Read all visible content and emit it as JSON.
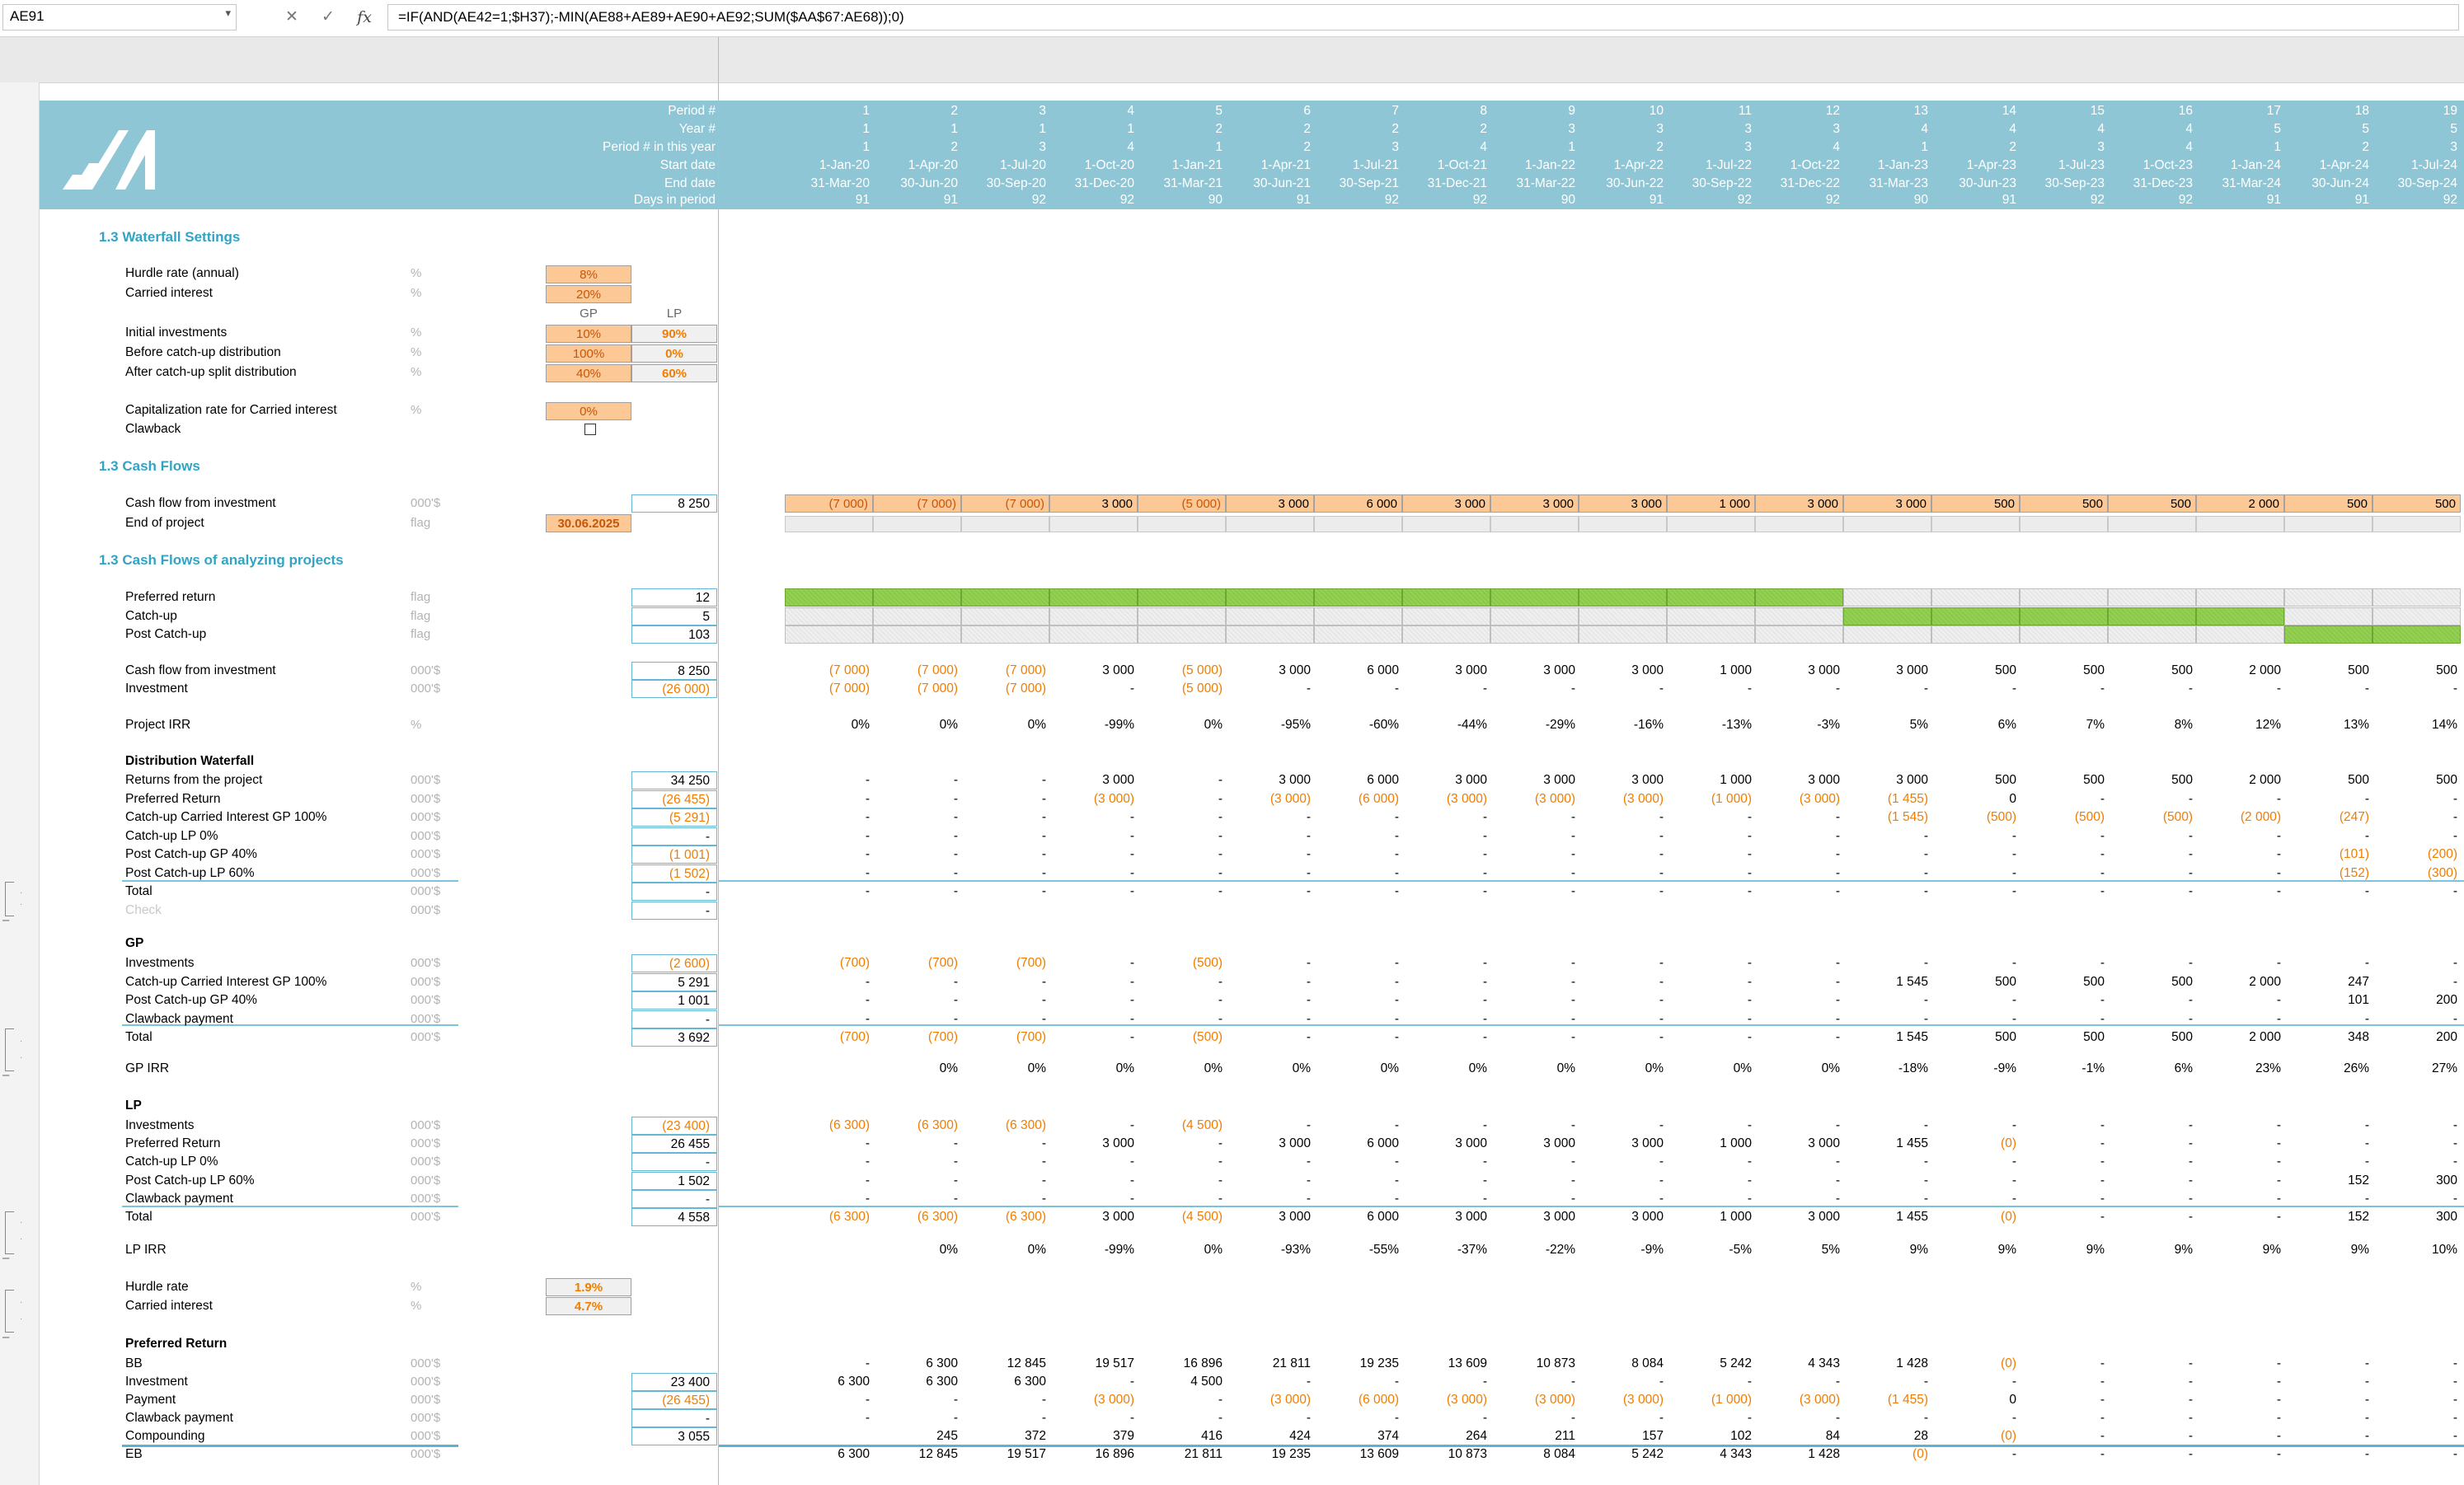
{
  "formula_bar": {
    "name_box": "AE91",
    "cancel_glyph": "✕",
    "enter_glyph": "✓",
    "fx_glyph": "fx",
    "formula": "=IF(AND(AE42=1;$H37);-MIN(AE88+AE89+AE90+AE92;SUM($AA$67:AE68));0)"
  },
  "header": {
    "period_label": "Period #",
    "year_label": "Year #",
    "period_in_year_label": "Period # in this year",
    "start_label": "Start date",
    "end_label": "End date",
    "days_label": "Days in period",
    "periods": [
      {
        "p": "1",
        "y": "1",
        "py": "1",
        "s": "1-Jan-20",
        "e": "31-Mar-20",
        "d": "91"
      },
      {
        "p": "2",
        "y": "1",
        "py": "2",
        "s": "1-Apr-20",
        "e": "30-Jun-20",
        "d": "91"
      },
      {
        "p": "3",
        "y": "1",
        "py": "3",
        "s": "1-Jul-20",
        "e": "30-Sep-20",
        "d": "92"
      },
      {
        "p": "4",
        "y": "1",
        "py": "4",
        "s": "1-Oct-20",
        "e": "31-Dec-20",
        "d": "92"
      },
      {
        "p": "5",
        "y": "2",
        "py": "1",
        "s": "1-Jan-21",
        "e": "31-Mar-21",
        "d": "90"
      },
      {
        "p": "6",
        "y": "2",
        "py": "2",
        "s": "1-Apr-21",
        "e": "30-Jun-21",
        "d": "91"
      },
      {
        "p": "7",
        "y": "2",
        "py": "3",
        "s": "1-Jul-21",
        "e": "30-Sep-21",
        "d": "92"
      },
      {
        "p": "8",
        "y": "2",
        "py": "4",
        "s": "1-Oct-21",
        "e": "31-Dec-21",
        "d": "92"
      },
      {
        "p": "9",
        "y": "3",
        "py": "1",
        "s": "1-Jan-22",
        "e": "31-Mar-22",
        "d": "90"
      },
      {
        "p": "10",
        "y": "3",
        "py": "2",
        "s": "1-Apr-22",
        "e": "30-Jun-22",
        "d": "91"
      },
      {
        "p": "11",
        "y": "3",
        "py": "3",
        "s": "1-Jul-22",
        "e": "30-Sep-22",
        "d": "92"
      },
      {
        "p": "12",
        "y": "3",
        "py": "4",
        "s": "1-Oct-22",
        "e": "31-Dec-22",
        "d": "92"
      },
      {
        "p": "13",
        "y": "4",
        "py": "1",
        "s": "1-Jan-23",
        "e": "31-Mar-23",
        "d": "90"
      },
      {
        "p": "14",
        "y": "4",
        "py": "2",
        "s": "1-Apr-23",
        "e": "30-Jun-23",
        "d": "91"
      },
      {
        "p": "15",
        "y": "4",
        "py": "3",
        "s": "1-Jul-23",
        "e": "30-Sep-23",
        "d": "92"
      },
      {
        "p": "16",
        "y": "4",
        "py": "4",
        "s": "1-Oct-23",
        "e": "31-Dec-23",
        "d": "92"
      },
      {
        "p": "17",
        "y": "5",
        "py": "1",
        "s": "1-Jan-24",
        "e": "31-Mar-24",
        "d": "91"
      },
      {
        "p": "18",
        "y": "5",
        "py": "2",
        "s": "1-Apr-24",
        "e": "30-Jun-24",
        "d": "91"
      },
      {
        "p": "19",
        "y": "5",
        "py": "3",
        "s": "1-Jul-24",
        "e": "30-Sep-24",
        "d": "92"
      }
    ]
  },
  "settings": {
    "title": "1.3  Waterfall Settings",
    "hurdle_label": "Hurdle rate (annual)",
    "hurdle_unit": "%",
    "hurdle_value": "8%",
    "carry_label": "Carried interest",
    "carry_unit": "%",
    "carry_value": "20%",
    "gp_header": "GP",
    "lp_header": "LP",
    "init_label": "Initial investments",
    "init_unit": "%",
    "init_gp": "10%",
    "init_lp": "90%",
    "before_label": "Before catch-up distribution",
    "before_unit": "%",
    "before_gp": "100%",
    "before_lp": "0%",
    "after_label": "After catch-up split distribution",
    "after_unit": "%",
    "after_gp": "40%",
    "after_lp": "60%",
    "cap_label": "Capitalization rate for Carried interest",
    "cap_unit": "%",
    "cap_value": "0%",
    "clawback_label": "Clawback"
  },
  "cashflows": {
    "title": "1.3  Cash Flows",
    "cf_label": "Cash flow from investment",
    "cf_unit": "000'$",
    "cf_total": "8 250",
    "cf_values": [
      "(7 000)",
      "(7 000)",
      "(7 000)",
      "3 000",
      "(5 000)",
      "3 000",
      "6 000",
      "3 000",
      "3 000",
      "3 000",
      "1 000",
      "3 000",
      "3 000",
      "500",
      "500",
      "500",
      "2 000",
      "500",
      "500"
    ],
    "eop_label": "End of project",
    "eop_unit": "flag",
    "eop_value": "30.06.2025"
  },
  "analyzing": {
    "title": "1.3  Cash Flows of analyzing projects",
    "pref_label": "Preferred return",
    "pref_unit": "flag",
    "pref_total": "12",
    "pref_flags": [
      1,
      1,
      1,
      1,
      1,
      1,
      1,
      1,
      1,
      1,
      1,
      1,
      0,
      0,
      0,
      0,
      0,
      0,
      0
    ],
    "catch_label": "Catch-up",
    "catch_unit": "flag",
    "catch_total": "5",
    "catch_flags": [
      0,
      0,
      0,
      0,
      0,
      0,
      0,
      0,
      0,
      0,
      0,
      0,
      1,
      1,
      1,
      1,
      1,
      0,
      0
    ],
    "post_label": "Post Catch-up",
    "post_unit": "flag",
    "post_total": "103",
    "post_flags": [
      0,
      0,
      0,
      0,
      0,
      0,
      0,
      0,
      0,
      0,
      0,
      0,
      0,
      0,
      0,
      0,
      0,
      1,
      1
    ],
    "cf2_label": "Cash flow from investment",
    "cf2_unit": "000'$",
    "cf2_total": "8 250",
    "cf2_values": [
      "(7 000)",
      "(7 000)",
      "(7 000)",
      "3 000",
      "(5 000)",
      "3 000",
      "6 000",
      "3 000",
      "3 000",
      "3 000",
      "1 000",
      "3 000",
      "3 000",
      "500",
      "500",
      "500",
      "2 000",
      "500",
      "500"
    ],
    "inv_label": "Investment",
    "inv_unit": "000'$",
    "inv_total": "(26 000)",
    "inv_values": [
      "(7 000)",
      "(7 000)",
      "(7 000)",
      "-",
      "(5 000)",
      "-",
      "-",
      "-",
      "-",
      "-",
      "-",
      "-",
      "-",
      "-",
      "-",
      "-",
      "-",
      "-",
      "-"
    ],
    "irr_label": "Project IRR",
    "irr_unit": "%",
    "irr_values": [
      "0%",
      "0%",
      "0%",
      "-99%",
      "0%",
      "-95%",
      "-60%",
      "-44%",
      "-29%",
      "-16%",
      "-13%",
      "-3%",
      "5%",
      "6%",
      "7%",
      "8%",
      "12%",
      "13%",
      "14%"
    ]
  },
  "waterfall": {
    "title": "Distribution Waterfall",
    "rows": [
      {
        "label": "Returns from the project",
        "unit": "000'$",
        "total": "34 250",
        "values": [
          "-",
          "-",
          "-",
          "3 000",
          "-",
          "3 000",
          "6 000",
          "3 000",
          "3 000",
          "3 000",
          "1 000",
          "3 000",
          "3 000",
          "500",
          "500",
          "500",
          "2 000",
          "500",
          "500"
        ]
      },
      {
        "label": "Preferred Return",
        "unit": "000'$",
        "total": "(26 455)",
        "values": [
          "-",
          "-",
          "-",
          "(3 000)",
          "-",
          "(3 000)",
          "(6 000)",
          "(3 000)",
          "(3 000)",
          "(3 000)",
          "(1 000)",
          "(3 000)",
          "(1 455)",
          "0",
          "-",
          "-",
          "-",
          "-",
          "-"
        ]
      },
      {
        "label": "Catch-up Carried Interest GP 100%",
        "unit": "000'$",
        "total": "(5 291)",
        "values": [
          "-",
          "-",
          "-",
          "-",
          "-",
          "-",
          "-",
          "-",
          "-",
          "-",
          "-",
          "-",
          "(1 545)",
          "(500)",
          "(500)",
          "(500)",
          "(2 000)",
          "(247)",
          "-"
        ]
      },
      {
        "label": "Catch-up LP 0%",
        "unit": "000'$",
        "total": "-",
        "values": [
          "-",
          "-",
          "-",
          "-",
          "-",
          "-",
          "-",
          "-",
          "-",
          "-",
          "-",
          "-",
          "-",
          "-",
          "-",
          "-",
          "-",
          "-",
          "-"
        ]
      },
      {
        "label": "Post Catch-up GP 40%",
        "unit": "000'$",
        "total": "(1 001)",
        "values": [
          "-",
          "-",
          "-",
          "-",
          "-",
          "-",
          "-",
          "-",
          "-",
          "-",
          "-",
          "-",
          "-",
          "-",
          "-",
          "-",
          "-",
          "(101)",
          "(200)"
        ]
      },
      {
        "label": "Post Catch-up LP 60%",
        "unit": "000'$",
        "total": "(1 502)",
        "values": [
          "-",
          "-",
          "-",
          "-",
          "-",
          "-",
          "-",
          "-",
          "-",
          "-",
          "-",
          "-",
          "-",
          "-",
          "-",
          "-",
          "-",
          "(152)",
          "(300)"
        ]
      },
      {
        "label": "Total",
        "unit": "000'$",
        "total": "-",
        "values": [
          "-",
          "-",
          "-",
          "-",
          "-",
          "-",
          "-",
          "-",
          "-",
          "-",
          "-",
          "-",
          "-",
          "-",
          "-",
          "-",
          "-",
          "-",
          "-"
        ]
      },
      {
        "label": "Check",
        "unit": "000'$",
        "total": "-",
        "values": []
      }
    ]
  },
  "gp": {
    "title": "GP",
    "rows": [
      {
        "label": "Investments",
        "unit": "000'$",
        "total": "(2 600)",
        "values": [
          "(700)",
          "(700)",
          "(700)",
          "-",
          "(500)",
          "-",
          "-",
          "-",
          "-",
          "-",
          "-",
          "-",
          "-",
          "-",
          "-",
          "-",
          "-",
          "-",
          "-"
        ]
      },
      {
        "label": "Catch-up Carried Interest GP 100%",
        "unit": "000'$",
        "total": "5 291",
        "values": [
          "-",
          "-",
          "-",
          "-",
          "-",
          "-",
          "-",
          "-",
          "-",
          "-",
          "-",
          "-",
          "1 545",
          "500",
          "500",
          "500",
          "2 000",
          "247",
          "-"
        ]
      },
      {
        "label": "Post Catch-up GP 40%",
        "unit": "000'$",
        "total": "1 001",
        "values": [
          "-",
          "-",
          "-",
          "-",
          "-",
          "-",
          "-",
          "-",
          "-",
          "-",
          "-",
          "-",
          "-",
          "-",
          "-",
          "-",
          "-",
          "101",
          "200"
        ]
      },
      {
        "label": "Clawback payment",
        "unit": "000'$",
        "total": "-",
        "values": [
          "-",
          "-",
          "-",
          "-",
          "-",
          "-",
          "-",
          "-",
          "-",
          "-",
          "-",
          "-",
          "-",
          "-",
          "-",
          "-",
          "-",
          "-",
          "-"
        ]
      },
      {
        "label": "Total",
        "unit": "000'$",
        "total": "3 692",
        "values": [
          "(700)",
          "(700)",
          "(700)",
          "-",
          "(500)",
          "-",
          "-",
          "-",
          "-",
          "-",
          "-",
          "-",
          "1 545",
          "500",
          "500",
          "500",
          "2 000",
          "348",
          "200"
        ]
      }
    ],
    "irr_label": "GP IRR",
    "irr_values": [
      "0%",
      "0%",
      "0%",
      "0%",
      "0%",
      "0%",
      "0%",
      "0%",
      "0%",
      "0%",
      "0%",
      "-18%",
      "-9%",
      "-1%",
      "6%",
      "23%",
      "26%",
      "27%"
    ]
  },
  "lp": {
    "title": "LP",
    "rows": [
      {
        "label": "Investments",
        "unit": "000'$",
        "total": "(23 400)",
        "values": [
          "(6 300)",
          "(6 300)",
          "(6 300)",
          "-",
          "(4 500)",
          "-",
          "-",
          "-",
          "-",
          "-",
          "-",
          "-",
          "-",
          "-",
          "-",
          "-",
          "-",
          "-",
          "-"
        ]
      },
      {
        "label": "Preferred Return",
        "unit": "000'$",
        "total": "26 455",
        "values": [
          "-",
          "-",
          "-",
          "3 000",
          "-",
          "3 000",
          "6 000",
          "3 000",
          "3 000",
          "3 000",
          "1 000",
          "3 000",
          "1 455",
          "(0)",
          "-",
          "-",
          "-",
          "-",
          "-"
        ]
      },
      {
        "label": "Catch-up LP 0%",
        "unit": "000'$",
        "total": "-",
        "values": [
          "-",
          "-",
          "-",
          "-",
          "-",
          "-",
          "-",
          "-",
          "-",
          "-",
          "-",
          "-",
          "-",
          "-",
          "-",
          "-",
          "-",
          "-",
          "-"
        ]
      },
      {
        "label": "Post Catch-up LP 60%",
        "unit": "000'$",
        "total": "1 502",
        "values": [
          "-",
          "-",
          "-",
          "-",
          "-",
          "-",
          "-",
          "-",
          "-",
          "-",
          "-",
          "-",
          "-",
          "-",
          "-",
          "-",
          "-",
          "152",
          "300"
        ]
      },
      {
        "label": "Clawback payment",
        "unit": "000'$",
        "total": "-",
        "values": [
          "-",
          "-",
          "-",
          "-",
          "-",
          "-",
          "-",
          "-",
          "-",
          "-",
          "-",
          "-",
          "-",
          "-",
          "-",
          "-",
          "-",
          "-",
          "-"
        ]
      },
      {
        "label": "Total",
        "unit": "000'$",
        "total": "4 558",
        "values": [
          "(6 300)",
          "(6 300)",
          "(6 300)",
          "3 000",
          "(4 500)",
          "3 000",
          "6 000",
          "3 000",
          "3 000",
          "3 000",
          "1 000",
          "3 000",
          "1 455",
          "(0)",
          "-",
          "-",
          "-",
          "152",
          "300"
        ]
      }
    ],
    "irr_label": "LP IRR",
    "irr_values": [
      "0%",
      "0%",
      "-99%",
      "0%",
      "-93%",
      "-55%",
      "-37%",
      "-22%",
      "-9%",
      "-5%",
      "5%",
      "9%",
      "9%",
      "9%",
      "9%",
      "9%",
      "9%",
      "10%"
    ]
  },
  "rates": {
    "hurdle_label": "Hurdle rate",
    "hurdle_unit": "%",
    "hurdle_value": "1.9%",
    "carry_label": "Carried interest",
    "carry_unit": "%",
    "carry_value": "4.7%"
  },
  "pref_return": {
    "title": "Preferred Return",
    "rows": [
      {
        "label": "BB",
        "unit": "000'$",
        "total": "",
        "values": [
          "-",
          "6 300",
          "12 845",
          "19 517",
          "16 896",
          "21 811",
          "19 235",
          "13 609",
          "10 873",
          "8 084",
          "5 242",
          "4 343",
          "1 428",
          "(0)",
          "-",
          "-",
          "-",
          "-",
          "-"
        ]
      },
      {
        "label": "Investment",
        "unit": "000'$",
        "total": "23 400",
        "values": [
          "6 300",
          "6 300",
          "6 300",
          "-",
          "4 500",
          "-",
          "-",
          "-",
          "-",
          "-",
          "-",
          "-",
          "-",
          "-",
          "-",
          "-",
          "-",
          "-",
          "-"
        ]
      },
      {
        "label": "Payment",
        "unit": "000'$",
        "total": "(26 455)",
        "values": [
          "-",
          "-",
          "-",
          "(3 000)",
          "-",
          "(3 000)",
          "(6 000)",
          "(3 000)",
          "(3 000)",
          "(3 000)",
          "(1 000)",
          "(3 000)",
          "(1 455)",
          "0",
          "-",
          "-",
          "-",
          "-",
          "-"
        ]
      },
      {
        "label": "Clawback payment",
        "unit": "000'$",
        "total": "-",
        "values": [
          "-",
          "-",
          "-",
          "-",
          "-",
          "-",
          "-",
          "-",
          "-",
          "-",
          "-",
          "-",
          "-",
          "-",
          "-",
          "-",
          "-",
          "-",
          "-"
        ]
      },
      {
        "label": "Compounding",
        "unit": "000'$",
        "total": "3 055",
        "values": [
          "",
          "245",
          "372",
          "379",
          "416",
          "424",
          "374",
          "264",
          "211",
          "157",
          "102",
          "84",
          "28",
          "(0)",
          "-",
          "-",
          "-",
          "-",
          "-"
        ]
      },
      {
        "label": "EB",
        "unit": "000'$",
        "total": "",
        "values": [
          "6 300",
          "12 845",
          "19 517",
          "16 896",
          "21 811",
          "19 235",
          "13 609",
          "10 873",
          "8 084",
          "5 242",
          "4 343",
          "1 428",
          "(0)",
          "-",
          "-",
          "-",
          "-",
          "-",
          "-"
        ]
      }
    ]
  },
  "colors": {
    "band": "#8ec6d6",
    "section_title": "#33a3c4",
    "negative": "#f07d00",
    "input": "#fcc896",
    "flag_on": "#92d050"
  }
}
